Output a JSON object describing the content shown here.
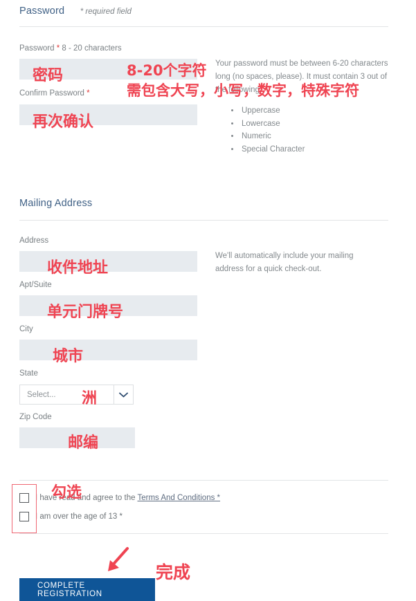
{
  "sections": {
    "password": {
      "title": "Password",
      "required_note": "* required field",
      "fields": {
        "password": {
          "label": "Password",
          "label_suffix": " 8 - 20 characters",
          "value": ""
        },
        "confirm": {
          "label": "Confirm Password",
          "value": ""
        }
      },
      "help": {
        "text": "Your password must be between 6-20 characters long (no spaces, please). It must contain 3 out of the following:",
        "bullets": [
          "Uppercase",
          "Lowercase",
          "Numeric",
          "Special Character"
        ]
      }
    },
    "mailing_address": {
      "title": "Mailing Address",
      "fields": {
        "address": {
          "label": "Address",
          "value": ""
        },
        "apt": {
          "label": "Apt/Suite",
          "value": ""
        },
        "city": {
          "label": "City",
          "value": ""
        },
        "state": {
          "label": "State",
          "selected": "Select..."
        },
        "zip": {
          "label": "Zip Code",
          "value": ""
        }
      },
      "help": {
        "text": "We'll automatically include your mailing address for a quick check-out."
      }
    }
  },
  "agreements": {
    "terms": {
      "text_before": "I have read and agree to the ",
      "link_text": "Terms And Conditions *"
    },
    "age": {
      "text": "I am over the age of 13 *"
    }
  },
  "submit": {
    "label": "COMPLETE REGISTRATION"
  },
  "annotations": {
    "password": "密码",
    "password_rule_line1": "8-20个字符",
    "password_rule_line2": "需包含大写，小写，数字，特殊字符",
    "confirm": "再次确认",
    "address": "收件地址",
    "apt": "单元门牌号",
    "city": "城市",
    "state": "洲",
    "zip": "邮编",
    "checkbox": "勾选",
    "submit": "完成"
  },
  "colors": {
    "annotation_red": "#ef4452",
    "button_blue": "#0f5597",
    "heading_blue": "#3f6085",
    "input_bg": "#e7ebef",
    "required_asterisk": "#e03a3a"
  },
  "icons": {
    "chevron_down": "chevron-down-icon"
  }
}
